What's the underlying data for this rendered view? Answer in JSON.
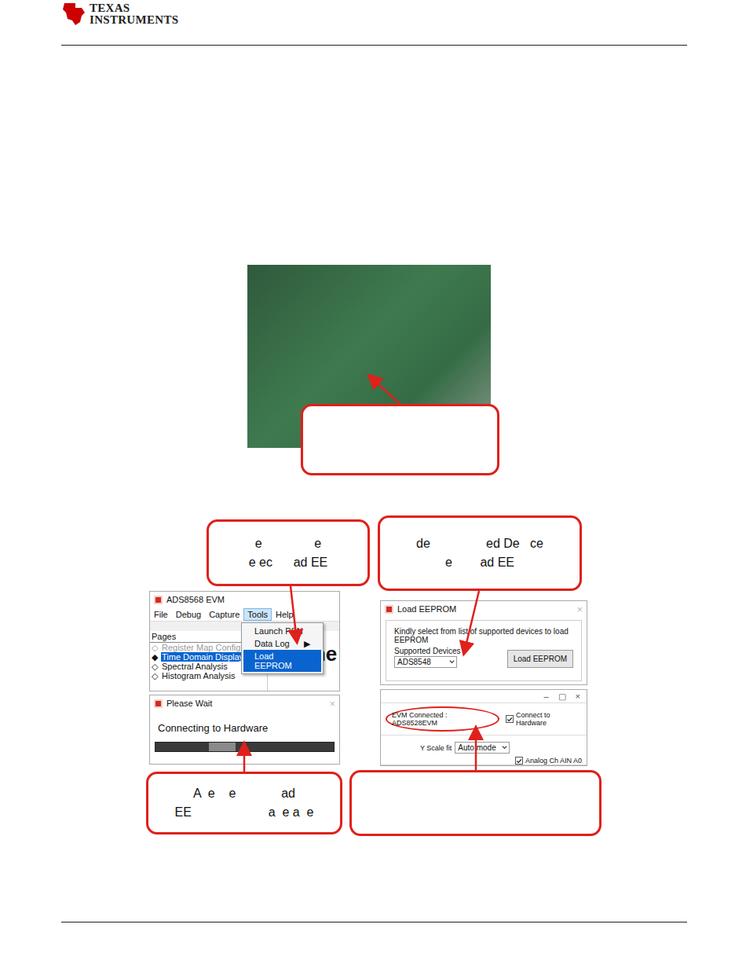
{
  "header": {
    "logo": {
      "line1": "TEXAS",
      "line2": "INSTRUMENTS"
    }
  },
  "figure1": {
    "photo": {
      "kind": "photograph"
    },
    "callout": {
      "lines": []
    }
  },
  "figure2": {
    "callouts_top": [
      {
        "lines": [
          "e               e",
          "e ec      ad EE"
        ]
      },
      {
        "lines": [
          "de                ed De   ce",
          "e        ad EE"
        ]
      }
    ],
    "main_window": {
      "title": "ADS8568 EVM",
      "menu": [
        {
          "label": "File",
          "selected": false
        },
        {
          "label": "Debug",
          "selected": false
        },
        {
          "label": "Capture",
          "selected": false
        },
        {
          "label": "Tools",
          "selected": true
        },
        {
          "label": "Help",
          "selected": false
        }
      ],
      "dropdown": [
        {
          "label": "Launch PSN",
          "submenu": false,
          "arrow": "",
          "selected": false
        },
        {
          "label": "Data Log",
          "submenu": true,
          "arrow": "▶",
          "selected": false
        },
        {
          "label": "Load EEPROM",
          "submenu": false,
          "arrow": "",
          "selected": true
        }
      ],
      "pages_label": "Pages",
      "pages": [
        {
          "label": "Register Map Config",
          "marker": "◇",
          "selected": false,
          "disabled": true
        },
        {
          "label": "Time Domain Display",
          "marker": "◆",
          "selected": true,
          "disabled": false
        },
        {
          "label": "Spectral Analysis",
          "marker": "◇",
          "selected": false,
          "disabled": false
        },
        {
          "label": "Histogram Analysis",
          "marker": "◇",
          "selected": false,
          "disabled": false
        }
      ],
      "heading": "Time"
    },
    "wait_dialog": {
      "title": "Please Wait",
      "close": "×",
      "message": "Connecting to Hardware",
      "level": 0.15
    },
    "load_dialog": {
      "title": "Load EEPROM",
      "close": "×",
      "prompt": "Kindly select from list of supported devices to load EEPROM",
      "field_label": "Supported Devices",
      "value": "ADS8548",
      "button": "Load EEPROM"
    },
    "status_window": {
      "controls": [
        "–",
        "▢",
        "×"
      ],
      "status": "EVM Connected : ADS8528EVM",
      "connect": {
        "label": "Connect to Hardware",
        "checked": true
      },
      "y_scale_label": "Y Scale fit",
      "y_scale_value": "Auto mode",
      "channel": {
        "label": "Analog Ch AIN A0",
        "checked": true
      }
    },
    "callouts_bottom": [
      {
        "lines": [
          "A  e    e             ad",
          "EE                      a  e a  e"
        ]
      },
      {
        "lines": []
      }
    ]
  }
}
